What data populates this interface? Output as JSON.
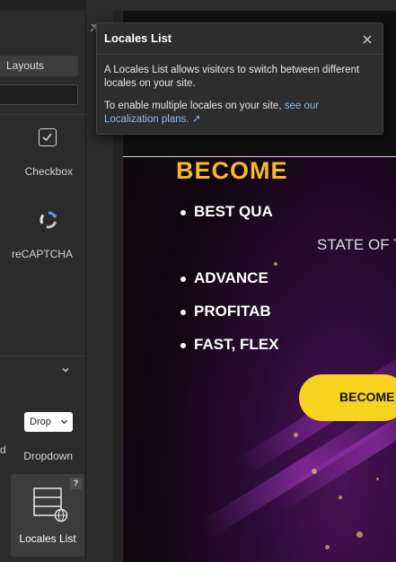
{
  "panel": {
    "layouts_label": "Layouts",
    "search_placeholder": "",
    "items": {
      "checkbox": "Checkbox",
      "recaptcha": "reCAPTCHA",
      "dropdown": "Dropdown",
      "dropdown_widget_text": "Drop",
      "locales_list": "Locales List",
      "locales_help": "?"
    },
    "left_cut_text": "d"
  },
  "popup": {
    "title": "Locales List",
    "body_1": "A Locales List allows visitors to switch between different locales on your site.",
    "body_2_prefix": "To enable multiple locales on your site,",
    "body_2_link": "see our Localization plans.",
    "link_arrow": "↗"
  },
  "site": {
    "heading": "BECOME",
    "bullets": [
      "BEST QUA",
      "STATE OF T",
      "ADVANCE",
      "PROFITAB",
      "FAST, FLEX"
    ],
    "cta_label": "BECOME"
  },
  "colors": {
    "heading": "#f5b92a",
    "cta": "#f7d21e",
    "link": "#8db8f0",
    "panel_bg": "#2b2b2b"
  }
}
